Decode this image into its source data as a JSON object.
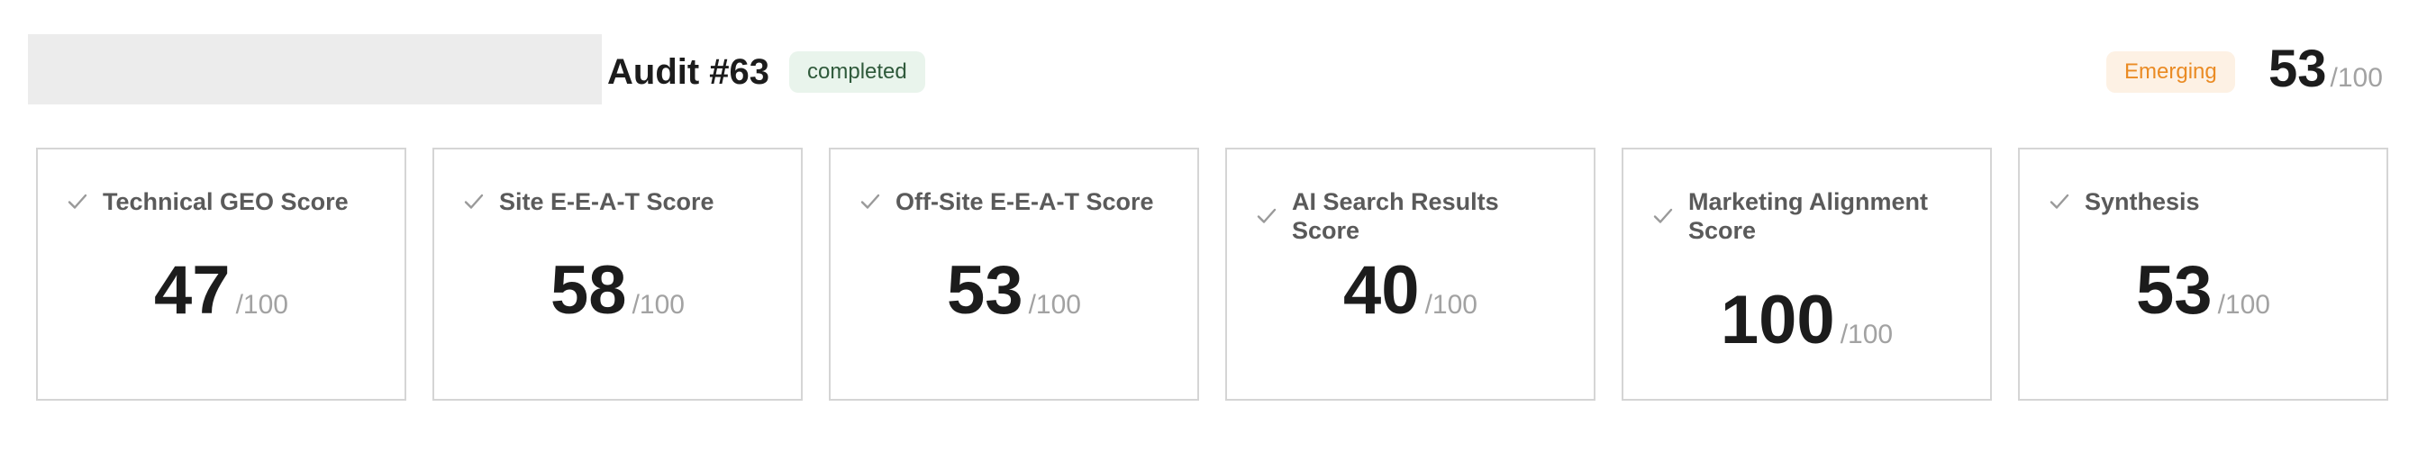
{
  "header": {
    "title": "Audit #63",
    "status": "completed",
    "level": "Emerging",
    "overall_score": "53",
    "overall_max": "/100"
  },
  "cards": [
    {
      "label": "Technical GEO Score",
      "score": "47",
      "max": "/100",
      "icon": "check-icon"
    },
    {
      "label": "Site E-E-A-T Score",
      "score": "58",
      "max": "/100",
      "icon": "check-icon"
    },
    {
      "label": "Off-Site E-E-A-T Score",
      "score": "53",
      "max": "/100",
      "icon": "check-icon"
    },
    {
      "label": "AI Search Results Score",
      "score": "40",
      "max": "/100",
      "icon": "check-icon"
    },
    {
      "label": "Marketing Alignment Score",
      "score": "100",
      "max": "/100",
      "icon": "check-icon"
    },
    {
      "label": "Synthesis",
      "score": "53",
      "max": "/100",
      "icon": "check-icon"
    }
  ],
  "colors": {
    "status_bg": "#e9f4ec",
    "status_text": "#2f5a3b",
    "level_bg": "#fdf1e4",
    "level_text": "#ea8b24",
    "card_border": "#d5d5d5"
  }
}
